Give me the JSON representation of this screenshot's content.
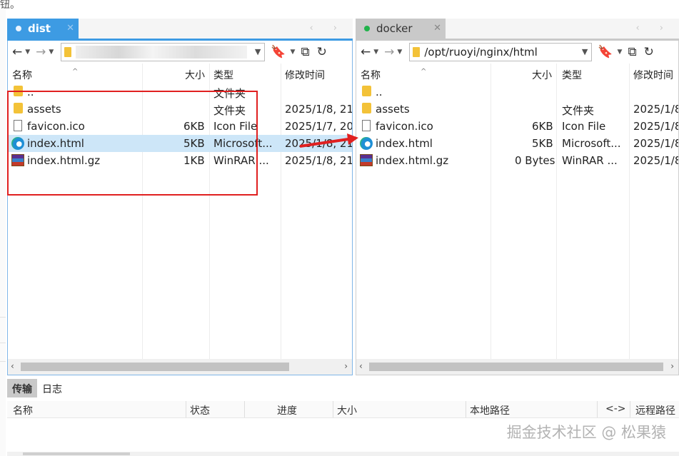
{
  "top_note": "钮。",
  "left_pane": {
    "tab_label": "dist",
    "tab_close": "✕",
    "tab_nav": "‹ ›",
    "path": "",
    "columns": {
      "name": "名称",
      "size": "大小",
      "type": "类型",
      "modified": "修改时间"
    },
    "rows": [
      {
        "name": "..",
        "size": "",
        "type": "文件夹",
        "modified": "",
        "icon": "folder-icon"
      },
      {
        "name": "assets",
        "size": "",
        "type": "文件夹",
        "modified": "2025/1/8, 21:",
        "icon": "folder-icon"
      },
      {
        "name": "favicon.ico",
        "size": "6KB",
        "type": "Icon File",
        "modified": "2025/1/7, 20:",
        "icon": "file-icon"
      },
      {
        "name": "index.html",
        "size": "5KB",
        "type": "Microsoft...",
        "modified": "2025/1/8, 21:",
        "icon": "edge-icon",
        "selected": true
      },
      {
        "name": "index.html.gz",
        "size": "1KB",
        "type": "WinRAR ...",
        "modified": "2025/1/8, 21:",
        "icon": "winrar-icon"
      }
    ]
  },
  "right_pane": {
    "tab_label": "docker",
    "tab_close": "✕",
    "tab_nav": "‹ ›",
    "path": "/opt/ruoyi/nginx/html",
    "columns": {
      "name": "名称",
      "size": "大小",
      "type": "类型",
      "modified": "修改时间"
    },
    "rows": [
      {
        "name": "..",
        "size": "",
        "type": "",
        "modified": "",
        "icon": "folder-icon"
      },
      {
        "name": "assets",
        "size": "",
        "type": "文件夹",
        "modified": "2025/1/8",
        "icon": "folder-icon"
      },
      {
        "name": "favicon.ico",
        "size": "6KB",
        "type": "Icon File",
        "modified": "2025/1/8",
        "icon": "file-icon"
      },
      {
        "name": "index.html",
        "size": "5KB",
        "type": "Microsoft...",
        "modified": "2025/1/8",
        "icon": "edge-icon"
      },
      {
        "name": "index.html.gz",
        "size": "0 Bytes",
        "type": "WinRAR ...",
        "modified": "2025/1/8",
        "icon": "winrar-icon"
      }
    ]
  },
  "bottom_panel": {
    "tabs": [
      {
        "label": "传输",
        "active": true
      },
      {
        "label": "日志",
        "active": false
      }
    ],
    "columns": {
      "name": "名称",
      "status": "状态",
      "progress": "进度",
      "size": "大小",
      "local_path": "本地路径",
      "direction": "<->",
      "remote_path": "远程路径"
    }
  },
  "watermark": "掘金技术社区 @ 松果猿",
  "colors": {
    "accent_blue": "#3d9be3",
    "selection": "#cde6f8",
    "annotation_red": "#e02020",
    "connected_green": "#21b34b"
  }
}
